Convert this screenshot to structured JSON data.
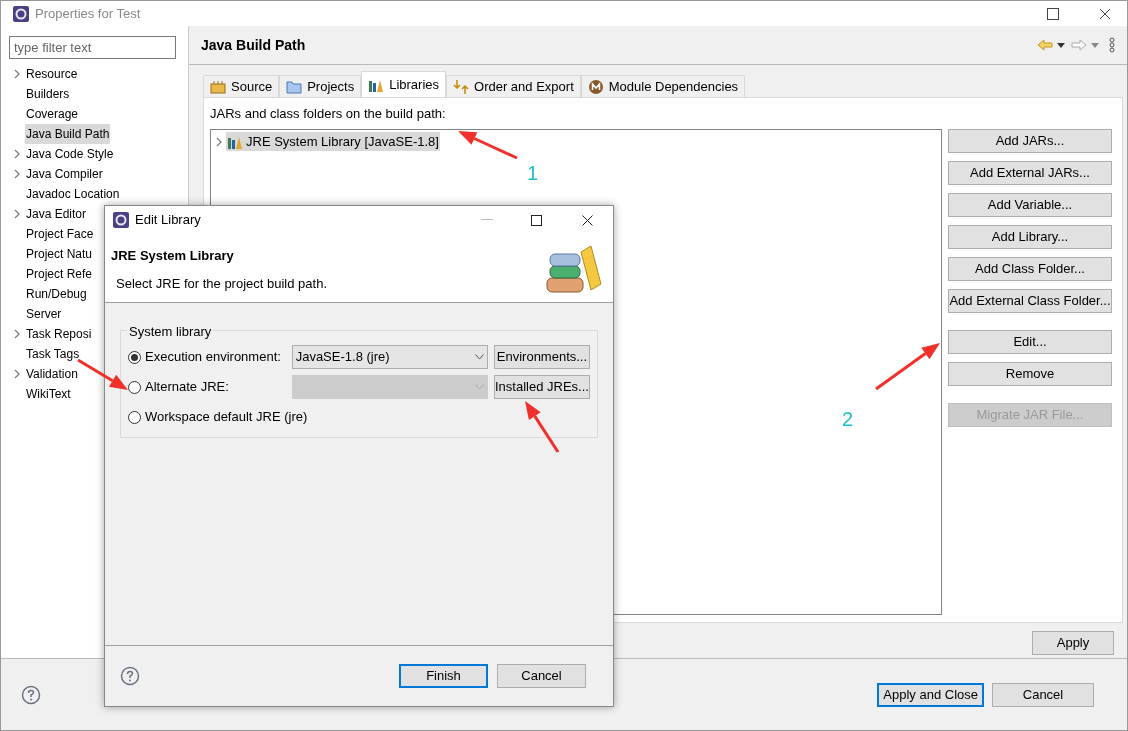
{
  "window": {
    "title": "Properties for Test"
  },
  "filter": {
    "placeholder": "type filter text"
  },
  "sidebar": {
    "items": [
      {
        "label": "Resource",
        "expandable": true,
        "selected": false
      },
      {
        "label": "Builders",
        "expandable": false,
        "selected": false
      },
      {
        "label": "Coverage",
        "expandable": false,
        "selected": false
      },
      {
        "label": "Java Build Path",
        "expandable": false,
        "selected": true
      },
      {
        "label": "Java Code Style",
        "expandable": true,
        "selected": false
      },
      {
        "label": "Java Compiler",
        "expandable": true,
        "selected": false
      },
      {
        "label": "Javadoc Location",
        "expandable": false,
        "selected": false
      },
      {
        "label": "Java Editor",
        "expandable": true,
        "selected": false
      },
      {
        "label": "Project Face",
        "expandable": false,
        "selected": false
      },
      {
        "label": "Project Natu",
        "expandable": false,
        "selected": false
      },
      {
        "label": "Project Refe",
        "expandable": false,
        "selected": false
      },
      {
        "label": "Run/Debug",
        "expandable": false,
        "selected": false
      },
      {
        "label": "Server",
        "expandable": false,
        "selected": false
      },
      {
        "label": "Task Reposi",
        "expandable": true,
        "selected": false
      },
      {
        "label": "Task Tags",
        "expandable": false,
        "selected": false
      },
      {
        "label": "Validation",
        "expandable": true,
        "selected": false
      },
      {
        "label": "WikiText",
        "expandable": false,
        "selected": false
      }
    ]
  },
  "page": {
    "title": "Java Build Path",
    "tabs": [
      {
        "label": "Source",
        "kind": "source",
        "selected": false
      },
      {
        "label": "Projects",
        "kind": "projects",
        "selected": false
      },
      {
        "label": "Libraries",
        "kind": "libraries",
        "selected": true
      },
      {
        "label": "Order and Export",
        "kind": "order",
        "selected": false
      },
      {
        "label": "Module Dependencies",
        "kind": "module",
        "selected": false
      }
    ],
    "list_label": "JARs and class folders on the build path:",
    "tree": [
      {
        "label": "JRE System Library [JavaSE-1.8]",
        "expanded": false,
        "selected": true
      }
    ],
    "button_groups": [
      [
        {
          "label": "Add JARs...",
          "disabled": false
        },
        {
          "label": "Add External JARs...",
          "disabled": false
        },
        {
          "label": "Add Variable...",
          "disabled": false
        },
        {
          "label": "Add Library...",
          "disabled": false
        },
        {
          "label": "Add Class Folder...",
          "disabled": false
        },
        {
          "label": "Add External Class Folder...",
          "disabled": false
        }
      ],
      [
        {
          "label": "Edit...",
          "disabled": false
        },
        {
          "label": "Remove",
          "disabled": false
        }
      ],
      [
        {
          "label": "Migrate JAR File...",
          "disabled": true
        }
      ]
    ],
    "apply": "Apply"
  },
  "footer": {
    "buttons": [
      {
        "label": "Apply and Close",
        "default": true
      },
      {
        "label": "Cancel",
        "default": false
      }
    ]
  },
  "dialog": {
    "title": "Edit Library",
    "heading": "JRE System Library",
    "description": "Select JRE for the project build path.",
    "group": "System library",
    "options": [
      {
        "label": "Execution environment:",
        "selected": true,
        "kind": "combo",
        "value": "JavaSE-1.8 (jre)",
        "disabled": false,
        "button": "Environments..."
      },
      {
        "label": "Alternate JRE:",
        "selected": false,
        "kind": "combo",
        "disabled": true,
        "button": "Installed JREs..."
      },
      {
        "label": "Workspace default JRE (jre)",
        "selected": false,
        "kind": "plain"
      }
    ],
    "buttons": [
      {
        "label": "Finish",
        "default": true
      },
      {
        "label": "Cancel",
        "default": false
      }
    ]
  },
  "annotations": [
    {
      "text": "1"
    },
    {
      "text": "2"
    }
  ]
}
